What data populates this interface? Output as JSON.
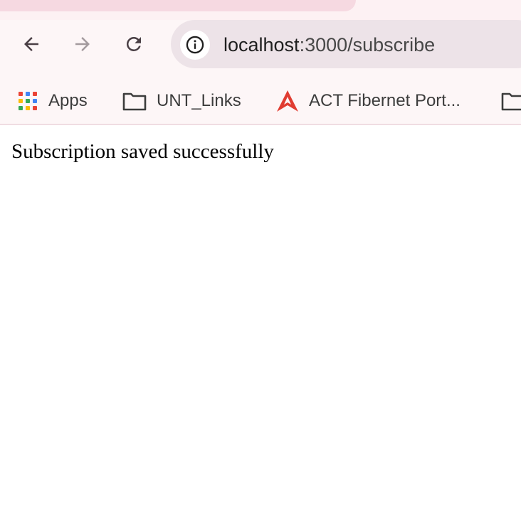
{
  "browser": {
    "url_host": "localhost",
    "url_rest": ":3000/subscribe",
    "navigation": {
      "back_icon": "arrow-left-icon",
      "forward_icon": "arrow-right-icon",
      "reload_icon": "reload-icon"
    },
    "site_info_icon": "info-icon"
  },
  "bookmarks": [
    {
      "label": "Apps",
      "icon": "apps-grid-icon"
    },
    {
      "label": "UNT_Links",
      "icon": "folder-icon"
    },
    {
      "label": "ACT Fibernet Port...",
      "icon": "act-logo-icon"
    },
    {
      "label": "",
      "icon": "folder-icon"
    }
  ],
  "colors": {
    "tab_active": "#f6d9e1",
    "toolbar_bg": "#fdf6f7",
    "omnibox_bg": "#ede3e8",
    "act_logo": "#e03c31"
  },
  "page": {
    "message": "Subscription saved successfully"
  }
}
